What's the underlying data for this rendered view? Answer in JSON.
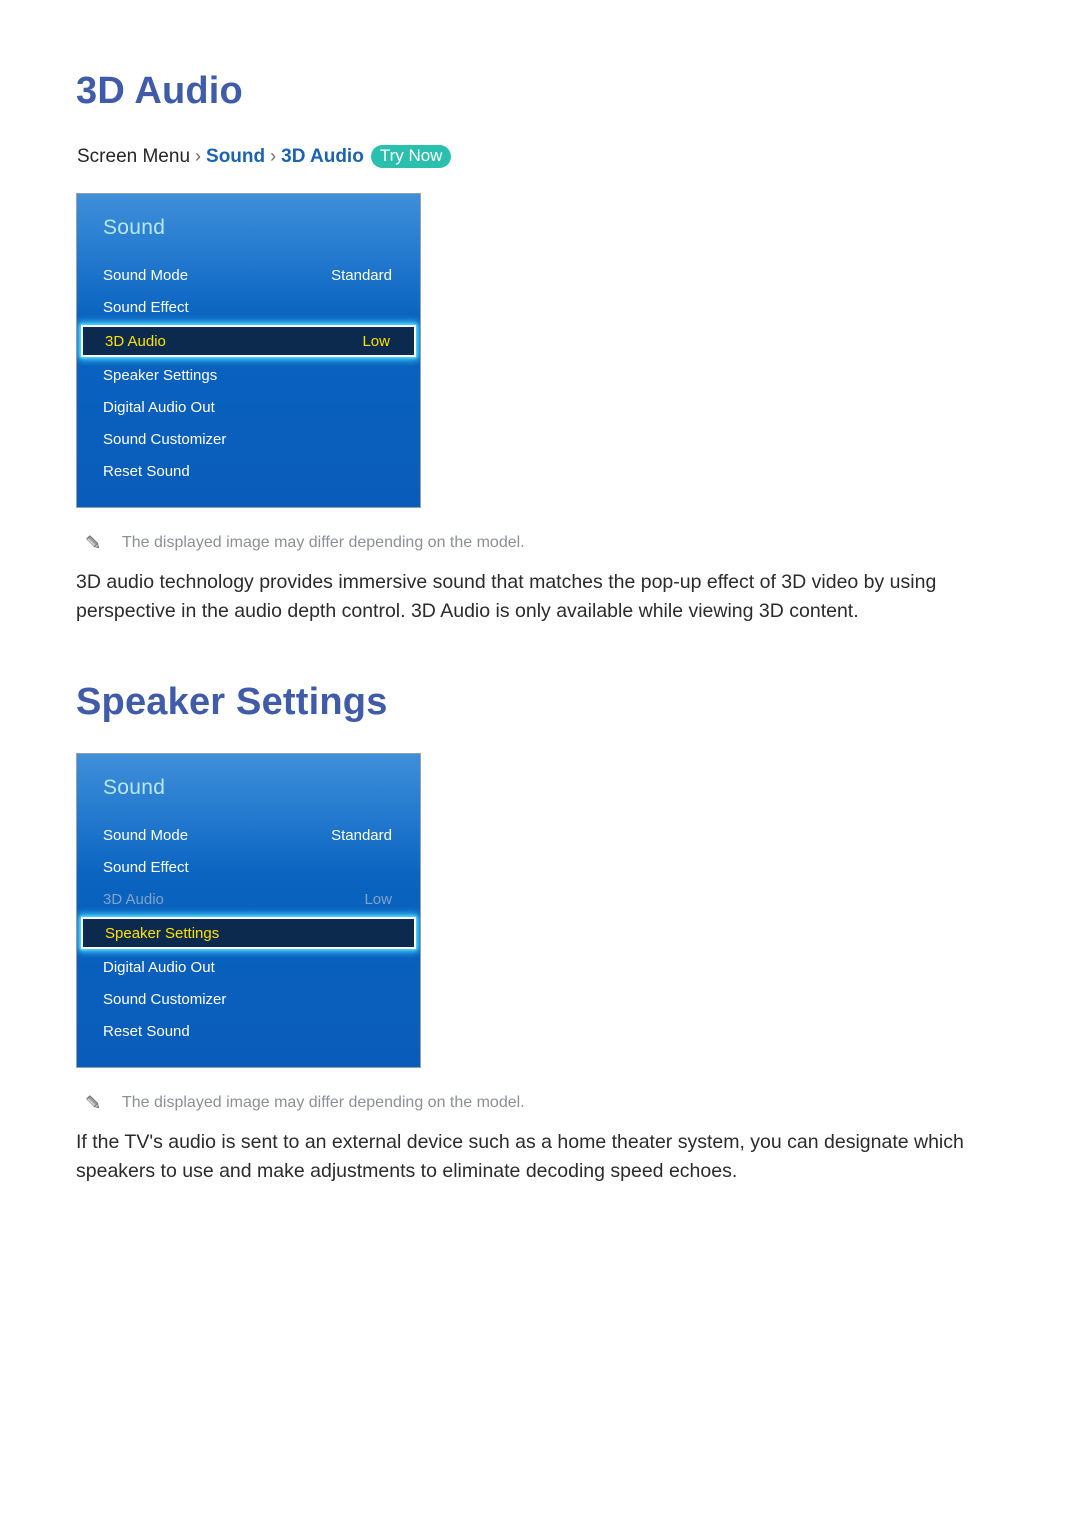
{
  "sections": [
    {
      "heading": "3D Audio",
      "breadcrumb": {
        "root": "Screen Menu",
        "sep1": "›",
        "link1": "Sound",
        "sep2": "›",
        "link2": "3D Audio",
        "badge": "Try Now"
      },
      "panel": {
        "title": "Sound",
        "rows": [
          {
            "label": "Sound Mode",
            "value": "Standard",
            "state": "normal"
          },
          {
            "label": "Sound Effect",
            "value": "",
            "state": "normal"
          },
          {
            "label": "3D Audio",
            "value": "Low",
            "state": "selected"
          },
          {
            "label": "Speaker Settings",
            "value": "",
            "state": "normal"
          },
          {
            "label": "Digital Audio Out",
            "value": "",
            "state": "normal"
          },
          {
            "label": "Sound Customizer",
            "value": "",
            "state": "normal"
          },
          {
            "label": "Reset Sound",
            "value": "",
            "state": "normal"
          }
        ]
      },
      "note": "The displayed image may differ depending on the model.",
      "body": "3D audio technology provides immersive sound that matches the pop-up effect of 3D video by using perspective in the audio depth control. 3D Audio is only available while viewing 3D content."
    },
    {
      "heading": "Speaker Settings",
      "panel": {
        "title": "Sound",
        "rows": [
          {
            "label": "Sound Mode",
            "value": "Standard",
            "state": "normal"
          },
          {
            "label": "Sound Effect",
            "value": "",
            "state": "normal"
          },
          {
            "label": "3D Audio",
            "value": "Low",
            "state": "dimmed"
          },
          {
            "label": "Speaker Settings",
            "value": "",
            "state": "selected"
          },
          {
            "label": "Digital Audio Out",
            "value": "",
            "state": "normal"
          },
          {
            "label": "Sound Customizer",
            "value": "",
            "state": "normal"
          },
          {
            "label": "Reset Sound",
            "value": "",
            "state": "normal"
          }
        ]
      },
      "note": "The displayed image may differ depending on the model.",
      "body": "If the TV's audio is sent to an external device such as a home theater system, you can designate which speakers to use and make adjustments to eliminate decoding speed echoes."
    }
  ],
  "icons": {
    "note_icon": "pencil-icon"
  },
  "colors": {
    "heading": "#3f5ba9",
    "link": "#1d63b4",
    "badge": "#2bbfae",
    "panel_blue": "#0a62bf",
    "selected_fill": "#0c2a4e",
    "selected_text": "#ffe100",
    "glow": "#3fd2ff",
    "dim_text": "#7fa3c9",
    "note_text": "#8b8f96",
    "body_text": "#2b2b2b"
  }
}
